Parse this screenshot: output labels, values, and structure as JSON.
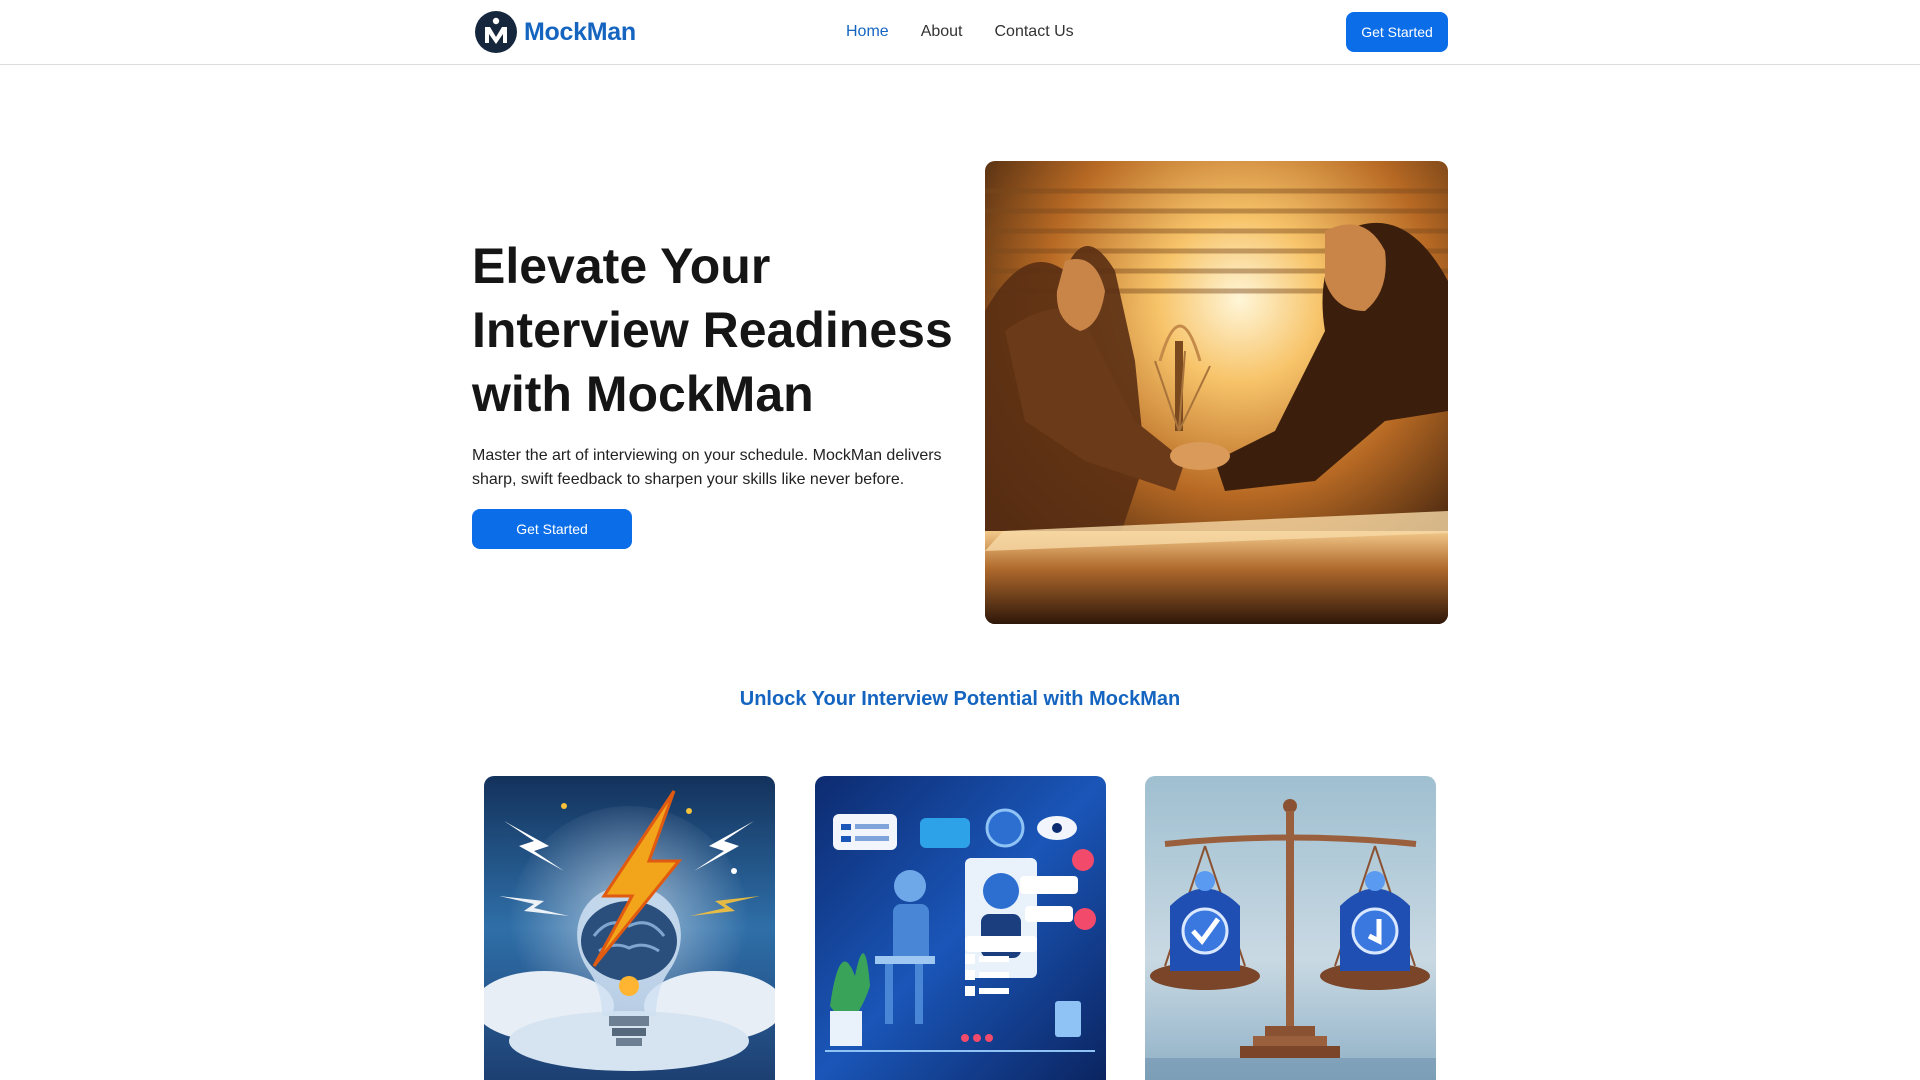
{
  "brand": {
    "name": "MockMan",
    "logo_icon": "mockman-logo-icon",
    "color": "#1565c0"
  },
  "nav": {
    "links": [
      {
        "label": "Home",
        "active": true
      },
      {
        "label": "About",
        "active": false
      },
      {
        "label": "Contact Us",
        "active": false
      }
    ],
    "cta_label": "Get Started"
  },
  "hero": {
    "title": "Elevate Your Interview Readiness with MockMan",
    "subtitle": "Master the art of interviewing on your schedule. MockMan delivers sharp, swift feedback to sharpen your skills like never before.",
    "cta_label": "Get Started",
    "image": "interview-handshake-image"
  },
  "features": {
    "title": "Unlock Your Interview Potential with MockMan",
    "cards": [
      {
        "image": "lightbulb-brain-lightning-image"
      },
      {
        "image": "ai-robot-interview-image"
      },
      {
        "image": "justice-scale-image"
      }
    ]
  },
  "colors": {
    "accent": "#0b6ee8",
    "heading": "#1565c0",
    "text": "#151515"
  }
}
